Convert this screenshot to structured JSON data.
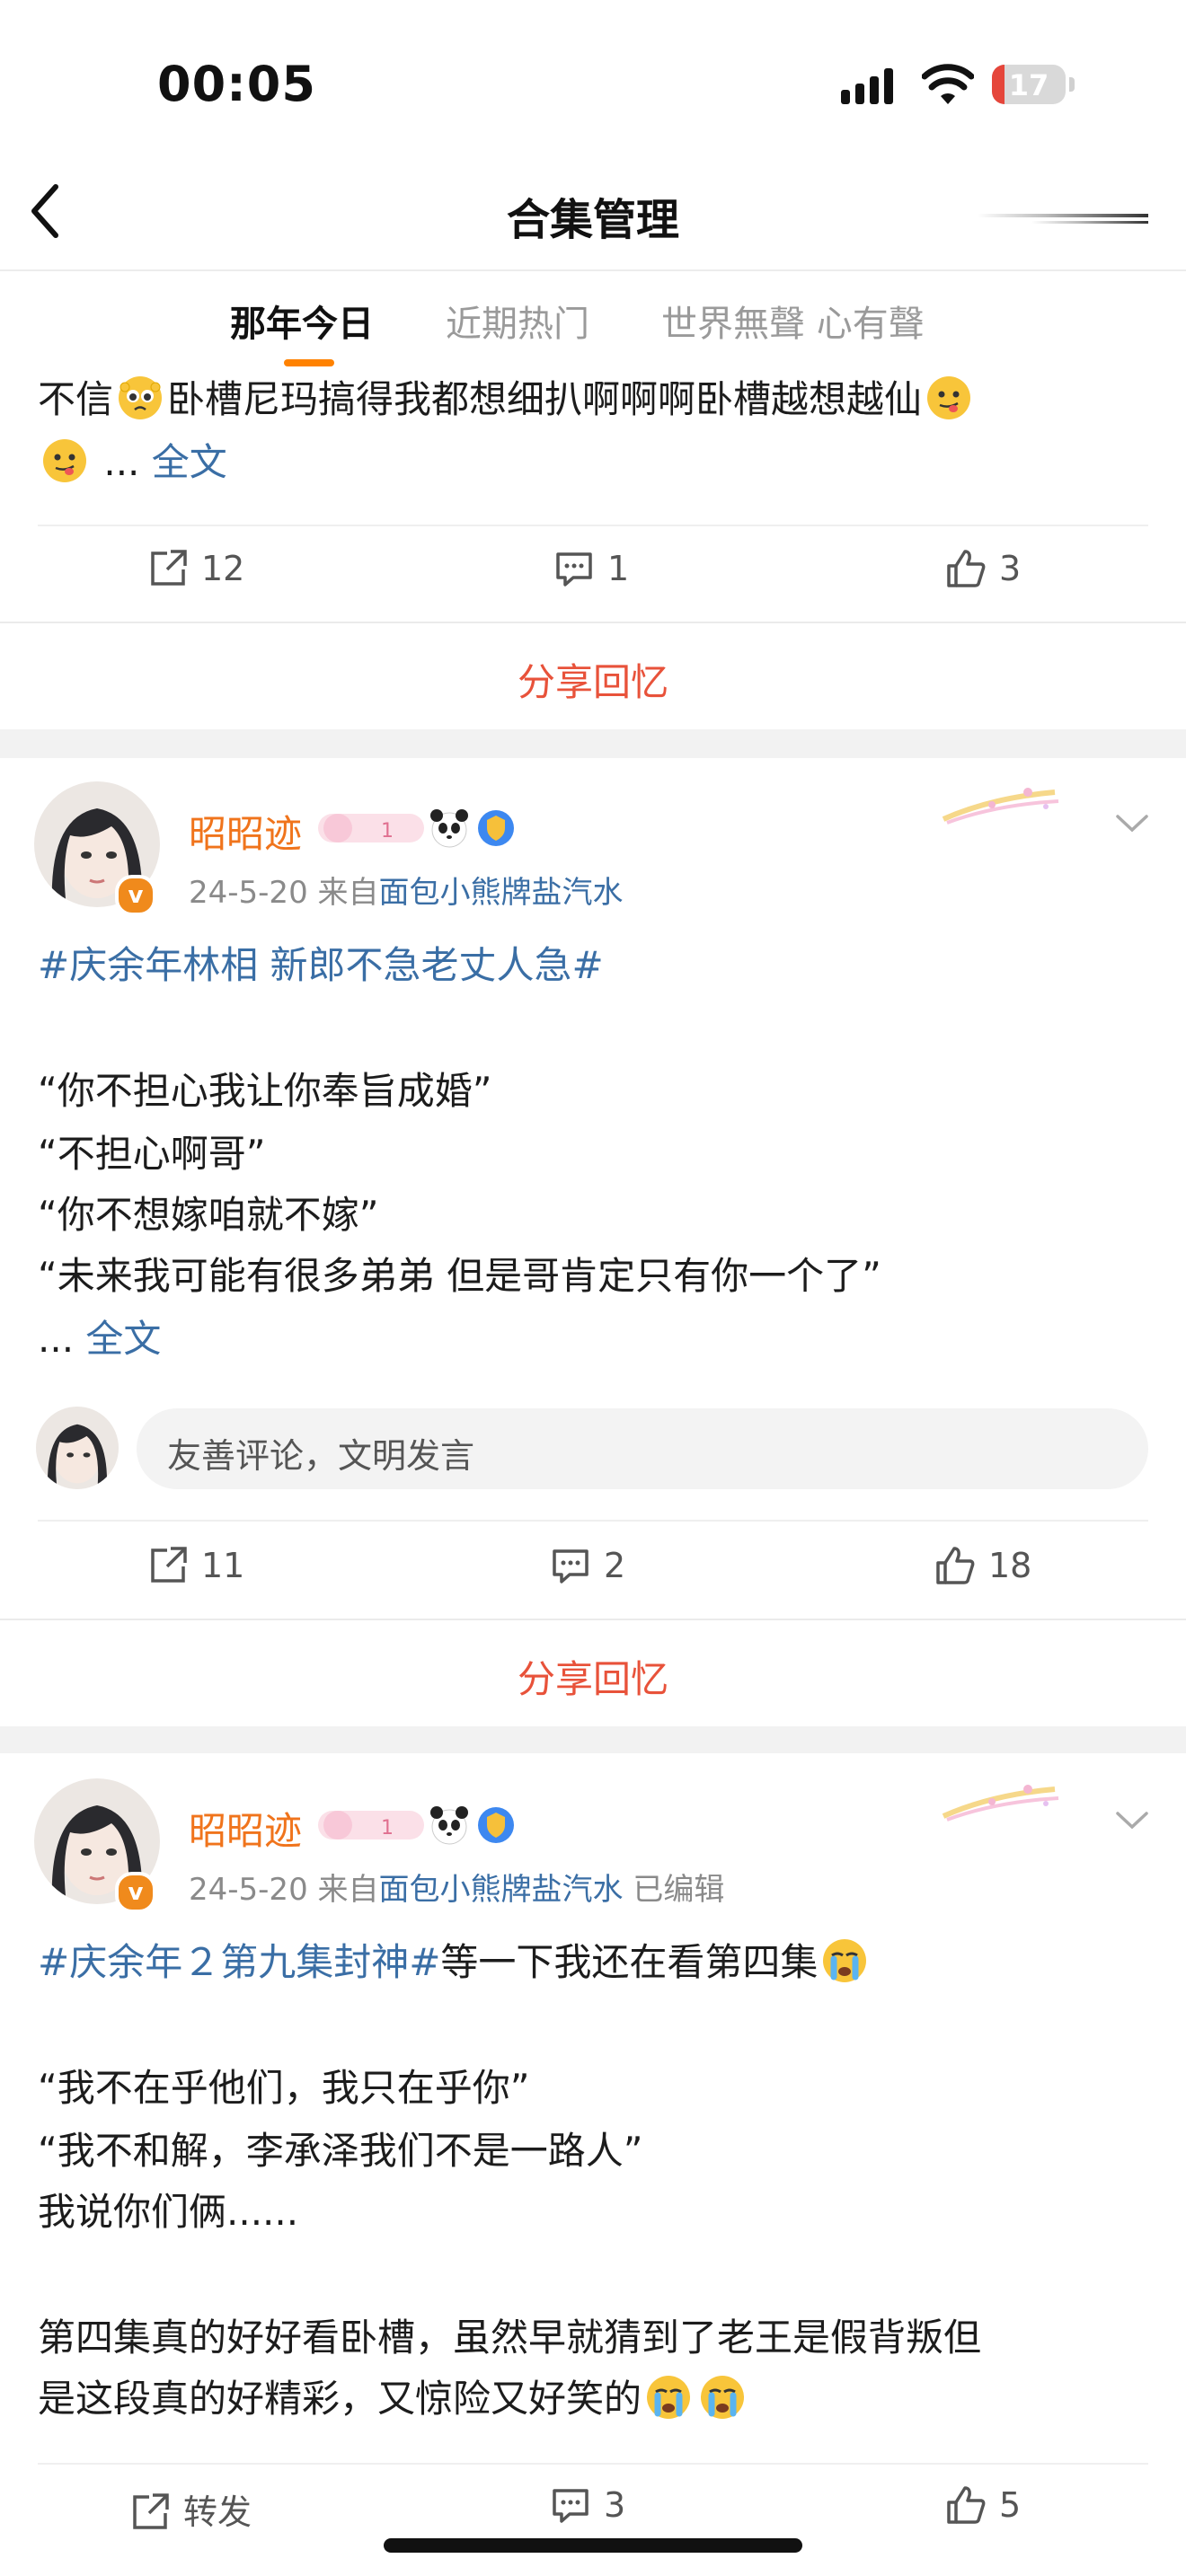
{
  "status": {
    "time": "00:05",
    "battery": "17",
    "battery_level": 0.17
  },
  "header": {
    "title": "合集管理"
  },
  "tabs": [
    {
      "label": "那年今日",
      "active": true
    },
    {
      "label": "近期热门",
      "active": false
    },
    {
      "label": "世界無聲 心有聲",
      "active": false
    }
  ],
  "post0": {
    "line1": "不信",
    "line1b": "卧槽尼玛搞得我都想细扒啊啊啊卧槽越想越仙",
    "ellipsis": "...",
    "full_text": "全文",
    "repost_count": "12",
    "comment_count": "1",
    "like_count": "3",
    "share_memory": "分享回忆"
  },
  "post1": {
    "username": "昭昭迹",
    "date": "24-5-20",
    "source_prefix": "来自",
    "source": "面包小熊牌盐汽水",
    "topic": "#庆余年林相 新郎不急老丈人急#",
    "lines": [
      "“你不担心我让你奉旨成婚”",
      "“不担心啊哥”",
      "“你不想嫁咱就不嫁”",
      "“未来我可能有很多弟弟 但是哥肯定只有你一个了”"
    ],
    "ellipsis": "...",
    "full_text": "全文",
    "comment_placeholder": "友善评论，文明发言",
    "repost_count": "11",
    "comment_count": "2",
    "like_count": "18",
    "share_memory": "分享回忆"
  },
  "post2": {
    "username": "昭昭迹",
    "date": "24-5-20",
    "source_prefix": "来自",
    "source": "面包小熊牌盐汽水",
    "edited": "已编辑",
    "topic": "#庆余年２第九集封神#",
    "topic_tail": "等一下我还在看第四集",
    "lines": [
      "“我不在乎他们，我只在乎你”",
      "“我不和解，李承泽我们不是一路人”",
      "我说你们俩......"
    ],
    "para2_line1": "第四集真的好好看卧槽，虽然早就猜到了老王是假背叛但",
    "para2_line2": "是这段真的好精彩，又惊险又好笑的",
    "repost_label": "转发",
    "comment_count": "3",
    "like_count": "5"
  },
  "colors": {
    "accent": "#ff8200",
    "link": "#3a6ea5",
    "share": "#e8523a",
    "username": "#f0741c"
  },
  "icons": [
    "chevron-left-icon",
    "repost-icon",
    "comment-icon",
    "like-icon",
    "verified-badge-icon",
    "chevron-down-icon",
    "panda-icon",
    "shield-badge-icon"
  ]
}
